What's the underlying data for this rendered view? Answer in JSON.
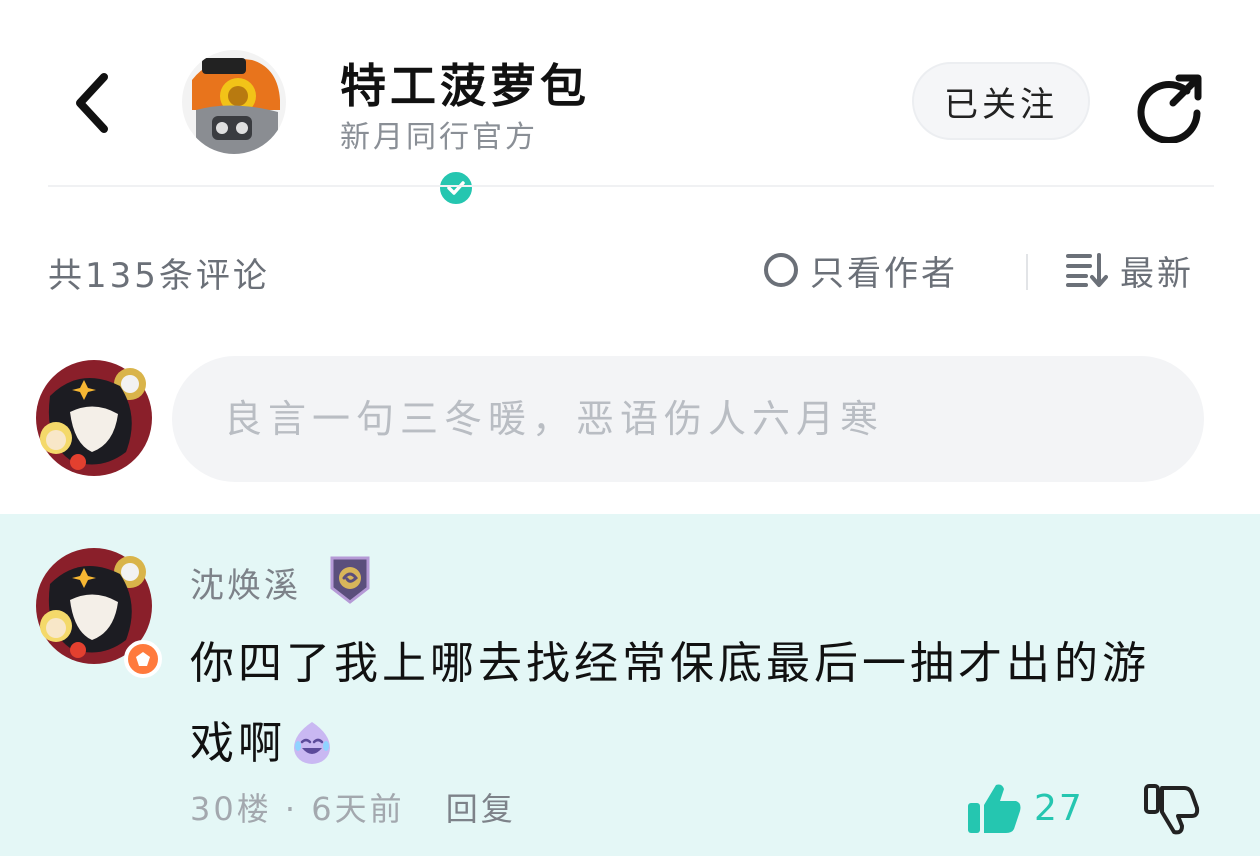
{
  "header": {
    "author_name": "特工菠萝包",
    "author_subtitle": "新月同行官方",
    "follow_label": "已关注"
  },
  "comments_bar": {
    "count_label": "共135条评论",
    "author_only_label": "只看作者",
    "sort_label": "最新"
  },
  "input": {
    "placeholder": "良言一句三冬暖，恶语伤人六月寒"
  },
  "comment": {
    "username": "沈焕溪",
    "text": "你四了我上哪去找经常保底最后一抽才出的游戏啊",
    "floor": "30楼",
    "time": "6天前",
    "reply_label": "回复",
    "likes": "27"
  },
  "colors": {
    "accent": "#25c6b0",
    "card_bg": "#e4f7f6",
    "input_bg": "#f3f4f6"
  }
}
